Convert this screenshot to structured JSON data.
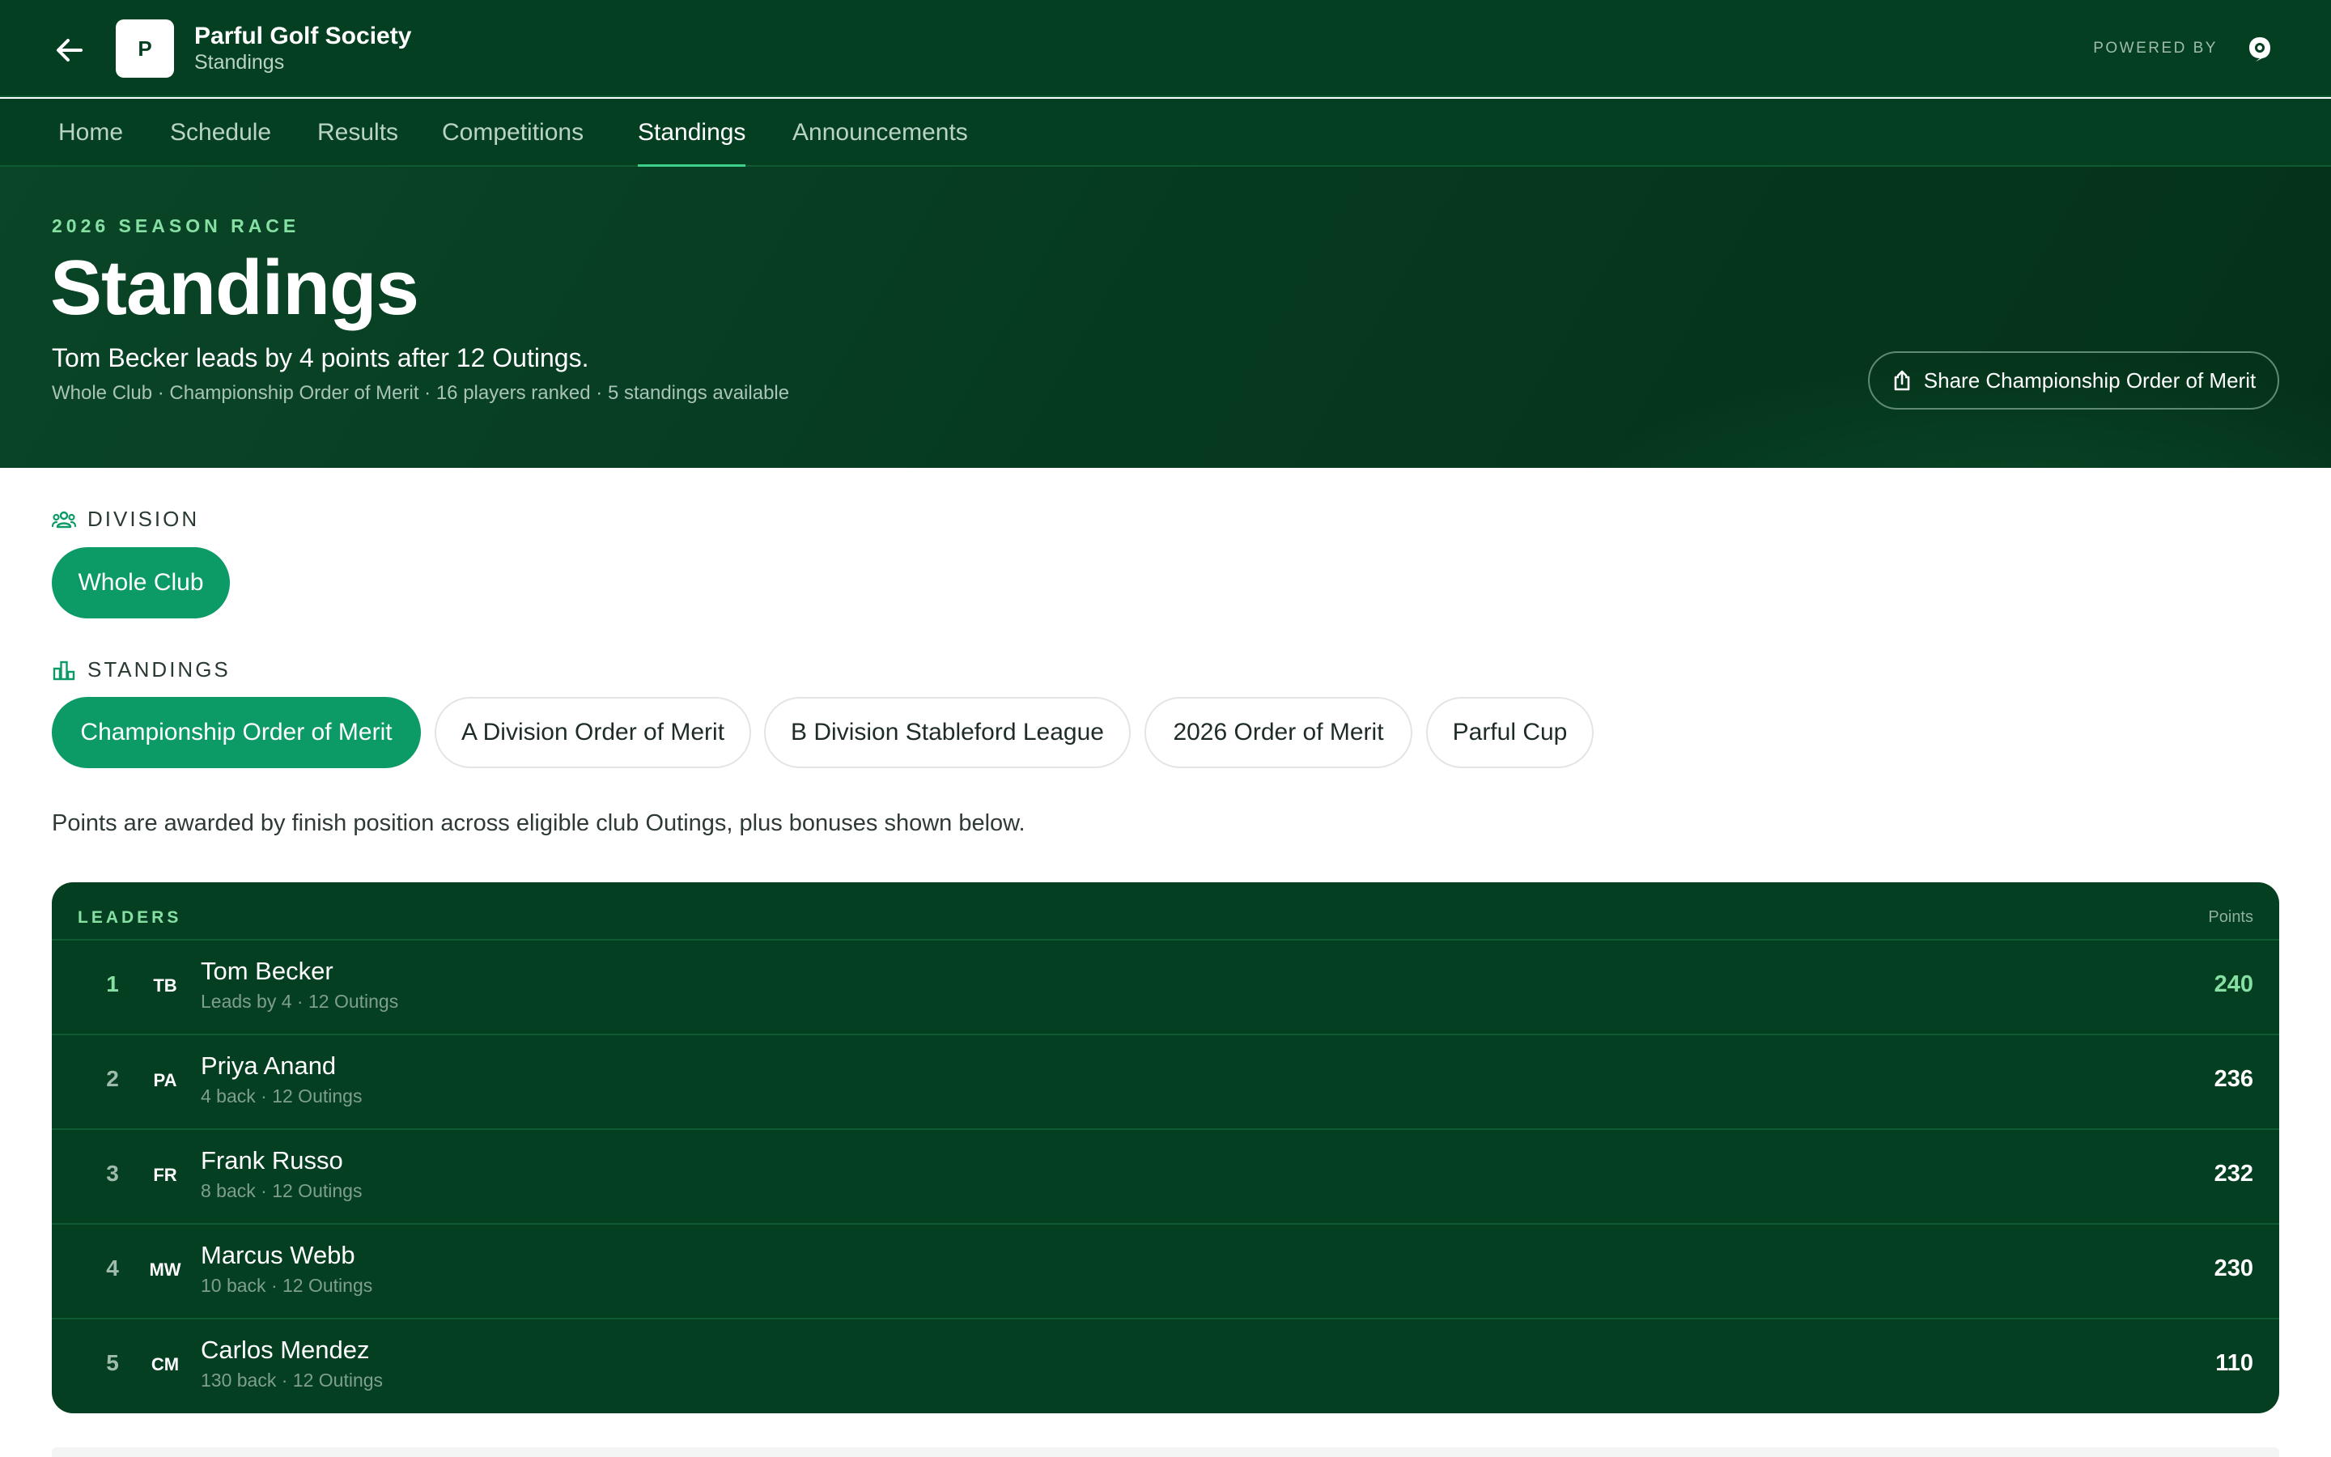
{
  "header": {
    "logo_letter": "P",
    "club_name": "Parful Golf Society",
    "page_subtitle": "Standings",
    "powered_by": "POWERED BY"
  },
  "nav": {
    "tabs": [
      {
        "label": "Home"
      },
      {
        "label": "Schedule"
      },
      {
        "label": "Results"
      },
      {
        "label": "Competitions"
      },
      {
        "label": "Standings",
        "active": true
      },
      {
        "label": "Announcements"
      }
    ]
  },
  "hero": {
    "eyebrow": "2026 SEASON RACE",
    "title": "Standings",
    "lead": "Tom Becker leads by 4 points after 12 Outings.",
    "meta": "Whole Club · Championship Order of Merit · 16 players ranked · 5 standings available",
    "share_label": "Share Championship Order of Merit"
  },
  "division": {
    "label": "DIVISION",
    "options": [
      {
        "label": "Whole Club",
        "selected": true
      }
    ]
  },
  "standings": {
    "label": "STANDINGS",
    "options": [
      {
        "label": "Championship Order of Merit",
        "selected": true
      },
      {
        "label": "A Division Order of Merit"
      },
      {
        "label": "B Division Stableford League"
      },
      {
        "label": "2026 Order of Merit"
      },
      {
        "label": "Parful Cup"
      }
    ]
  },
  "note": "Points are awarded by finish position across eligible club Outings, plus bonuses shown below.",
  "leaders": {
    "title": "LEADERS",
    "points_header": "Points",
    "rows": [
      {
        "rank": "1",
        "initials": "TB",
        "name": "Tom Becker",
        "meta": "Leads by 4 · 12 Outings",
        "points": "240"
      },
      {
        "rank": "2",
        "initials": "PA",
        "name": "Priya Anand",
        "meta": "4 back · 12 Outings",
        "points": "236"
      },
      {
        "rank": "3",
        "initials": "FR",
        "name": "Frank Russo",
        "meta": "8 back · 12 Outings",
        "points": "232"
      },
      {
        "rank": "4",
        "initials": "MW",
        "name": "Marcus Webb",
        "meta": "10 back · 12 Outings",
        "points": "230"
      },
      {
        "rank": "5",
        "initials": "CM",
        "name": "Carlos Mendez",
        "meta": "130 back · 12 Outings",
        "points": "110"
      }
    ]
  },
  "colors": {
    "brand_dark": "#053f21",
    "accent_green": "#0c9a66",
    "highlight": "#86e0a3"
  },
  "icons": [
    "arrow-left-icon",
    "powered-by-logo-icon",
    "share-icon",
    "group-icon",
    "podium-icon"
  ]
}
